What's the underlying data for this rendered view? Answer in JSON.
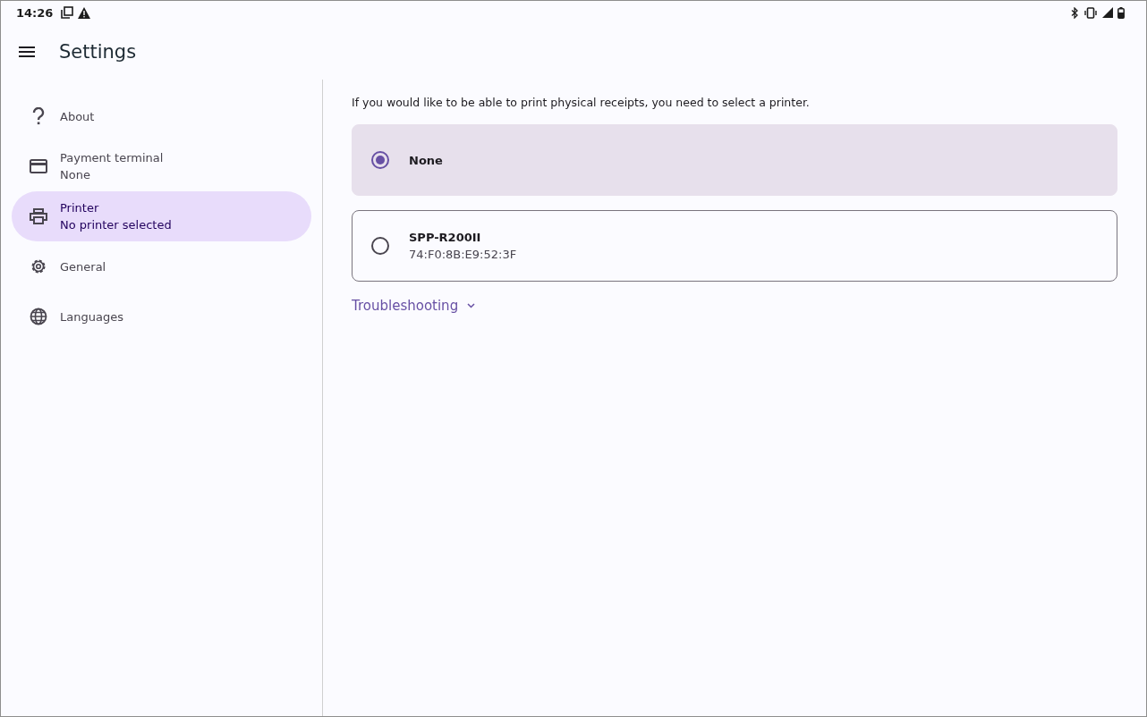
{
  "status_bar": {
    "time": "14:26"
  },
  "app_bar": {
    "title": "Settings"
  },
  "sidebar": {
    "items": [
      {
        "kind": "help",
        "label": "About",
        "selected": false
      },
      {
        "kind": "card",
        "label": "Payment terminal",
        "subtitle": "None",
        "selected": false
      },
      {
        "kind": "printer",
        "label": "Printer",
        "subtitle": "No printer selected",
        "selected": true
      },
      {
        "kind": "gear",
        "label": "General",
        "selected": false
      },
      {
        "kind": "globe",
        "label": "Languages",
        "selected": false
      }
    ]
  },
  "content": {
    "intro": "If you would like to be able to print physical receipts, you need to select a printer.",
    "printers": [
      {
        "name": "None",
        "selected": true
      },
      {
        "name": "SPP-R200II",
        "address": "74:F0:8B:E9:52:3F",
        "selected": false
      }
    ],
    "troubleshooting": {
      "label": "Troubleshooting",
      "expanded": false
    }
  }
}
